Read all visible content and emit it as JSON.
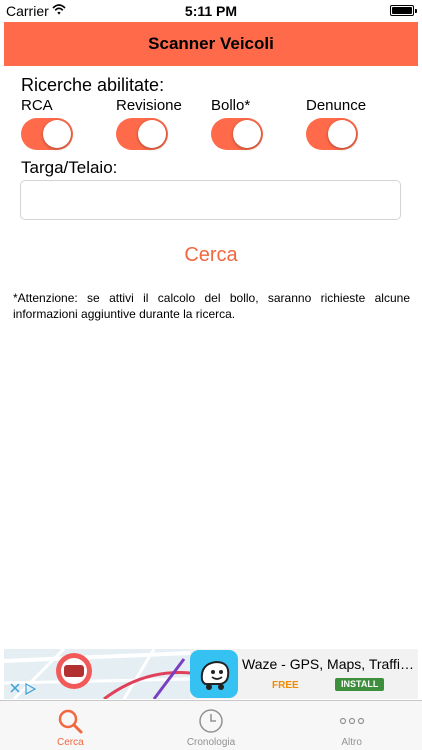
{
  "status_bar": {
    "carrier": "Carrier",
    "time": "5:11 PM"
  },
  "header": {
    "title": "Scanner Veicoli",
    "background": "#ff6b4a"
  },
  "search_options": {
    "section_label": "Ricerche abilitate:",
    "toggles": [
      {
        "label": "RCA",
        "on": true
      },
      {
        "label": "Revisione",
        "on": true
      },
      {
        "label": "Bollo*",
        "on": true
      },
      {
        "label": "Denunce",
        "on": true
      }
    ]
  },
  "plate_field": {
    "label": "Targa/Telaio:",
    "value": "",
    "placeholder": ""
  },
  "search_button": {
    "label": "Cerca",
    "color": "#f1673f"
  },
  "notice": "*Attenzione: se attivi il calcolo del bollo, saranno richieste alcune informazioni aggiuntive durante la ricerca.",
  "ad": {
    "title": "Waze - GPS, Maps, Traffic ...",
    "price": "FREE",
    "install_label": "INSTALL",
    "app_icon": "waze-icon"
  },
  "tab_bar": {
    "active_color": "#f1673f",
    "tabs": [
      {
        "label": "Cerca",
        "icon": "magnifier-icon",
        "active": true
      },
      {
        "label": "Cronologia",
        "icon": "clock-icon",
        "active": false
      },
      {
        "label": "Altro",
        "icon": "more-icon",
        "active": false
      }
    ]
  }
}
